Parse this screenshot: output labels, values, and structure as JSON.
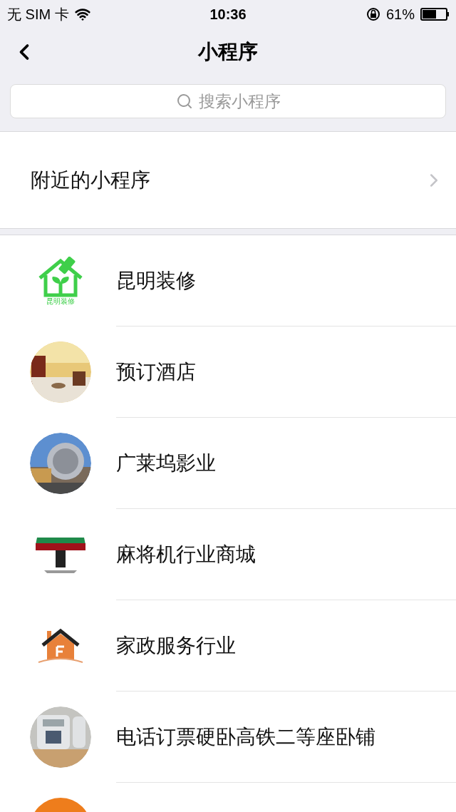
{
  "status_bar": {
    "carrier": "无 SIM 卡",
    "time": "10:36",
    "battery": "61%"
  },
  "nav": {
    "title": "小程序"
  },
  "search": {
    "placeholder": "搜索小程序"
  },
  "nearby": {
    "label": "附近的小程序"
  },
  "apps": [
    {
      "kind": "logo-house",
      "logo_text": "昆明装修",
      "name": "昆明装修"
    },
    {
      "kind": "photo-hotel",
      "name": "预订酒店"
    },
    {
      "kind": "photo-globe",
      "name": "广莱坞影业"
    },
    {
      "kind": "mahjong-table",
      "name": "麻将机行业商城"
    },
    {
      "kind": "house-f",
      "name": "家政服务行业"
    },
    {
      "kind": "photo-phone",
      "name": "电话订票硬卧高铁二等座卧铺"
    },
    {
      "kind": "orange-circle"
    }
  ]
}
